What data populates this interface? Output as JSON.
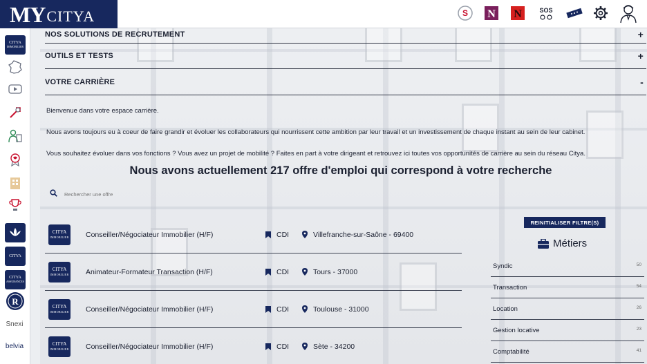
{
  "app": {
    "logo_my": "MY",
    "logo_citya": "CITYA"
  },
  "topbar": {
    "icons": [
      "s-logo-icon",
      "n-logo-icon",
      "n-red-logo-icon",
      "sos-icon",
      "ticket-icon",
      "gear-icon",
      "user-icon"
    ]
  },
  "sidebar": {
    "badge_citya": "CITYA",
    "badge_immobilier": "IMMOBILIER",
    "badge_assurances": "ASSURANCES",
    "sidebar_brand_snexi": "Snexi",
    "sidebar_brand_belvia": "belvia"
  },
  "accordion": {
    "recruitment": {
      "label": "NOS SOLUTIONS DE RECRUTEMENT",
      "sign": "+"
    },
    "tools": {
      "label": "OUTILS ET TESTS",
      "sign": "+"
    },
    "career": {
      "label": "VOTRE CARRIÈRE",
      "sign": "-"
    }
  },
  "career": {
    "welcome": "Bienvenue dans votre espace carrière.",
    "intro": "Nous avons toujours eu à coeur de faire grandir et évoluer les collaborateurs qui nourrissent cette ambition par leur travail et un investissement de chaque instant au sein de leur cabinet.",
    "mobility": "Vous souhaitez évoluer dans vos fonctions ? Vous avez un projet de mobilité ? Faites en part à votre dirigeant et retrouvez ici toutes vos opportunités de carrière au sein du réseau Citya.",
    "headline": "Nous avons actuellement 217 offre d'emploi qui correspond à votre recherche"
  },
  "search": {
    "placeholder": "Rechercher une offre"
  },
  "jobs": [
    {
      "title": "Conseiller/Négociateur Immobilier (H/F)",
      "type": "CDI",
      "location": "Villefranche-sur-Saône - 69400"
    },
    {
      "title": "Animateur-Formateur Transaction (H/F)",
      "type": "CDI",
      "location": "Tours - 37000"
    },
    {
      "title": "Conseiller/Négociateur Immobilier (H/F)",
      "type": "CDI",
      "location": "Toulouse - 31000"
    },
    {
      "title": "Conseiller/Négociateur Immobilier (H/F)",
      "type": "CDI",
      "location": "Sète - 34200"
    }
  ],
  "job_logo": {
    "brand": "CITYA",
    "sub": "IMMOBILIER"
  },
  "filters": {
    "reset_label": "REINITIALISER FILTRE(S)",
    "title": "Métiers",
    "items": [
      {
        "label": "Syndic",
        "count": "50"
      },
      {
        "label": "Transaction",
        "count": "54"
      },
      {
        "label": "Location",
        "count": "26"
      },
      {
        "label": "Gestion locative",
        "count": "23"
      },
      {
        "label": "Comptabilité",
        "count": "41"
      }
    ]
  },
  "colors": {
    "brand_navy": "#17285e",
    "brand_red": "#c8102e",
    "text": "#1b2030"
  }
}
